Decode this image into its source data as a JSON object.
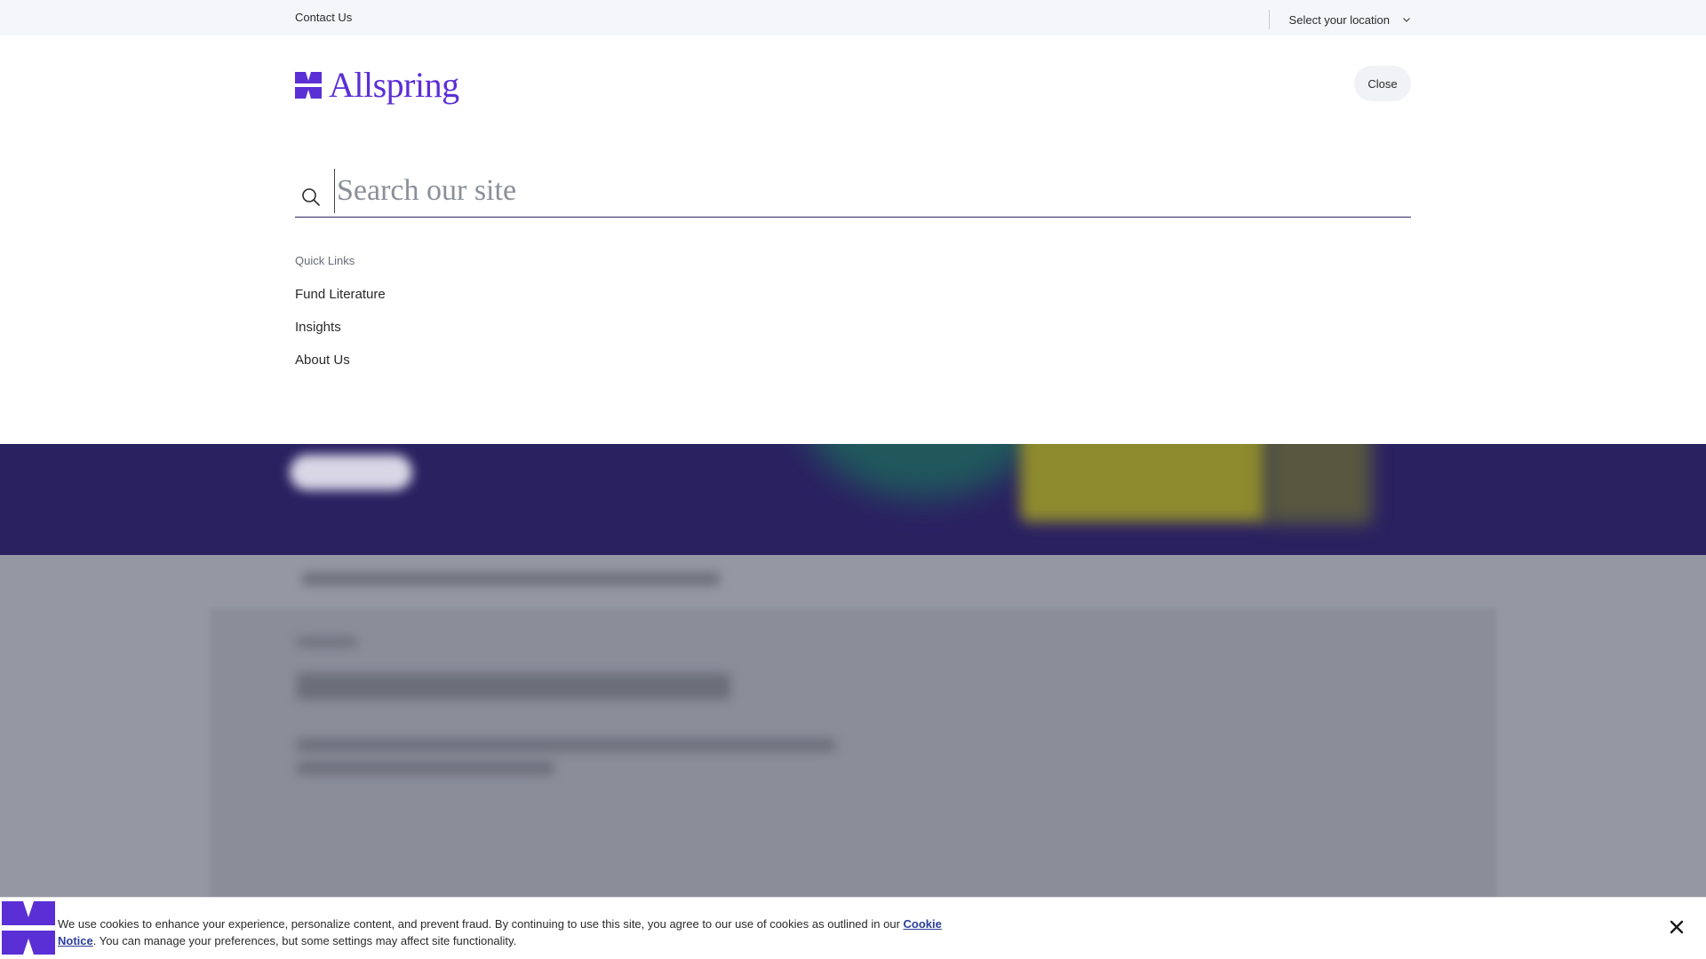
{
  "utility_bar": {
    "contact_label": "Contact Us",
    "location_label": "Select your location"
  },
  "header": {
    "logo_text": "Allspring",
    "close_label": "Close"
  },
  "search": {
    "placeholder": "Search our site",
    "value": ""
  },
  "quick_links": {
    "title": "Quick Links",
    "items": [
      {
        "label": "Fund Literature"
      },
      {
        "label": "Insights"
      },
      {
        "label": "About Us"
      }
    ]
  },
  "cookie_banner": {
    "text_before_link": "We use cookies to enhance your experience, personalize content, and prevent fraud. By continuing to use this site, you agree to our use of cookies as outlined in our ",
    "link_label": "Cookie Notice",
    "text_after_link": ". You can manage your preferences, but some settings may affect site functionality."
  },
  "colors": {
    "brand": "#5b2fd6",
    "hero_background": "#2a2161",
    "overlay": "#9598a2",
    "link": "#2b3e9b"
  },
  "icons": {
    "search": "search-icon",
    "chevron": "chevron-down-icon",
    "close": "close-icon",
    "logo": "allspring-logo-icon"
  }
}
